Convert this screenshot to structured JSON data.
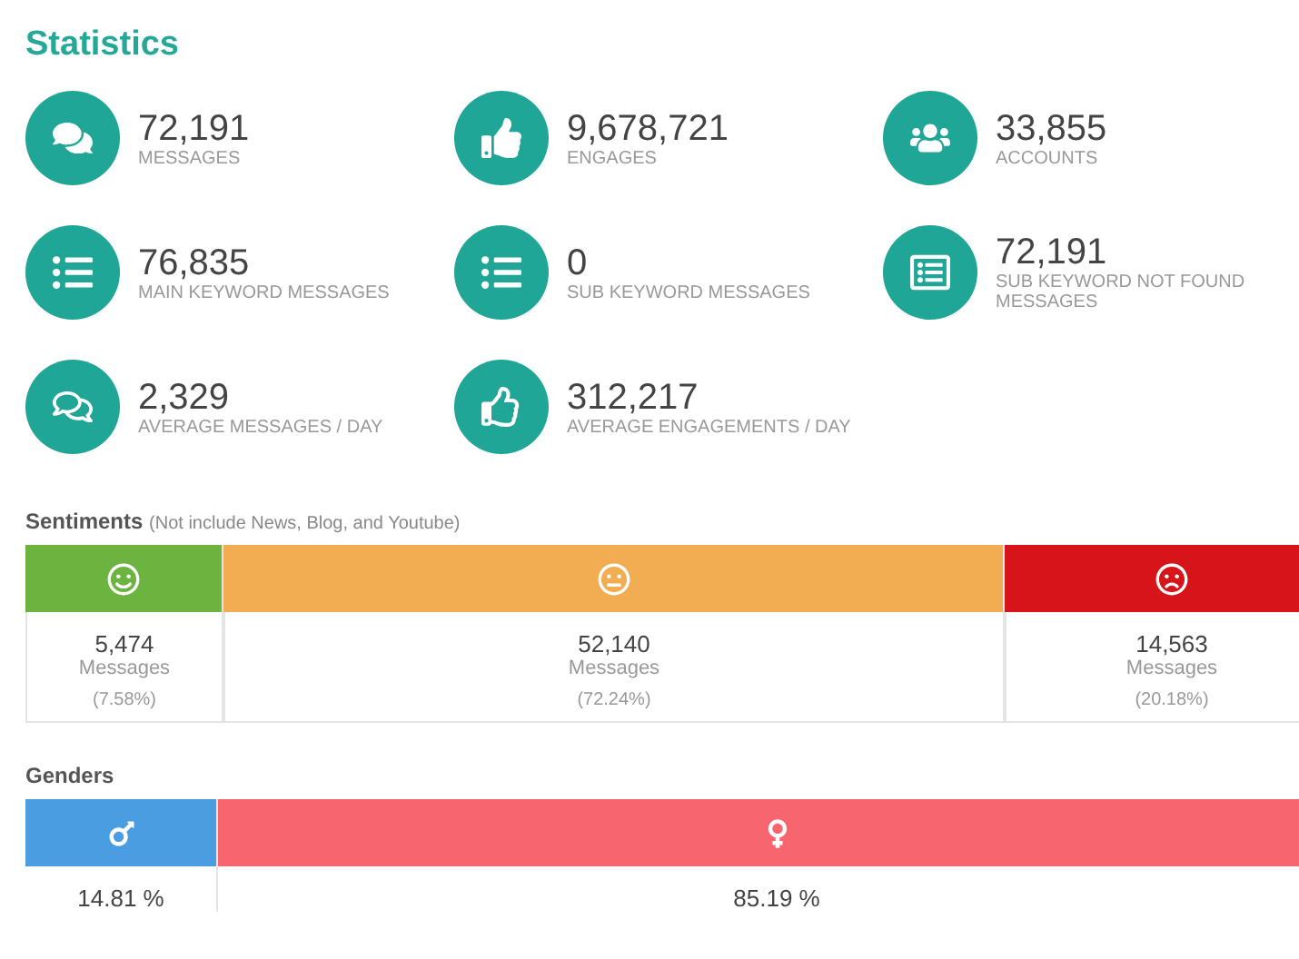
{
  "title": "Statistics",
  "stats": [
    {
      "kind": "comments",
      "value": "72,191",
      "label": "MESSAGES"
    },
    {
      "kind": "thumbs",
      "value": "9,678,721",
      "label": "ENGAGES"
    },
    {
      "kind": "users",
      "value": "33,855",
      "label": "ACCOUNTS"
    },
    {
      "kind": "list",
      "value": "76,835",
      "label": "MAIN KEYWORD MESSAGES"
    },
    {
      "kind": "list",
      "value": "0",
      "label": "SUB KEYWORD MESSAGES"
    },
    {
      "kind": "table",
      "value": "72,191",
      "label": "SUB KEYWORD NOT FOUND MESSAGES"
    },
    {
      "kind": "comments-outline",
      "value": "2,329",
      "label": "AVERAGE MESSAGES / DAY"
    },
    {
      "kind": "thumbs-outline",
      "value": "312,217",
      "label": "AVERAGE ENGAGEMENTS / DAY"
    }
  ],
  "sentiments": {
    "title": "Sentiments",
    "note": "(Not include News, Blog, and Youtube)",
    "items": [
      {
        "kind": "positive",
        "color": "#6cb33f",
        "count": "5,474",
        "unit": "Messages",
        "share": "(7.58%)"
      },
      {
        "kind": "neutral",
        "color": "#f2ac52",
        "count": "52,140",
        "unit": "Messages",
        "share": "(72.24%)"
      },
      {
        "kind": "negative",
        "color": "#d7141a",
        "count": "14,563",
        "unit": "Messages",
        "share": "(20.18%)"
      }
    ]
  },
  "genders": {
    "title": "Genders",
    "items": [
      {
        "kind": "male",
        "color": "#4a9de0",
        "share": "14.81 %"
      },
      {
        "kind": "female",
        "color": "#f7666e",
        "share": "85.19 %"
      }
    ]
  }
}
